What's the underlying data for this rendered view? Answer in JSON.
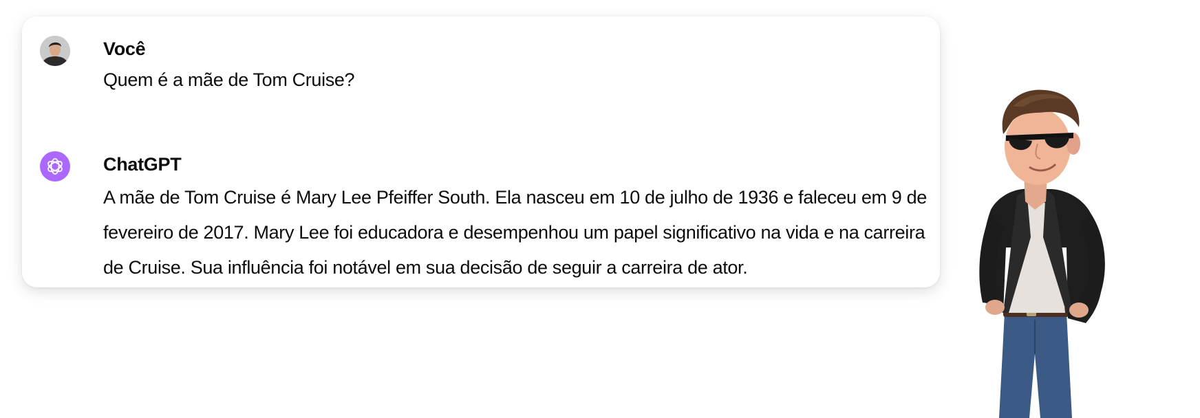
{
  "conversation": {
    "user": {
      "author": "Você",
      "text": "Quem é a mãe de Tom Cruise?",
      "avatar_icon": "user-photo-avatar"
    },
    "assistant": {
      "author": "ChatGPT",
      "text": "A mãe de Tom Cruise é Mary Lee Pfeiffer South. Ela nasceu em 10 de julho de 1936 e faleceu em 9 de fevereiro de 2017. Mary Lee foi educadora e desempenhou um papel significativo na vida e na carreira de Cruise. Sua influência foi notável em sua decisão de seguir a carreira de ator.",
      "avatar_icon": "openai-logo-icon",
      "avatar_color": "#ab68ff"
    }
  },
  "illustration": {
    "subject": "cartoon-character"
  }
}
